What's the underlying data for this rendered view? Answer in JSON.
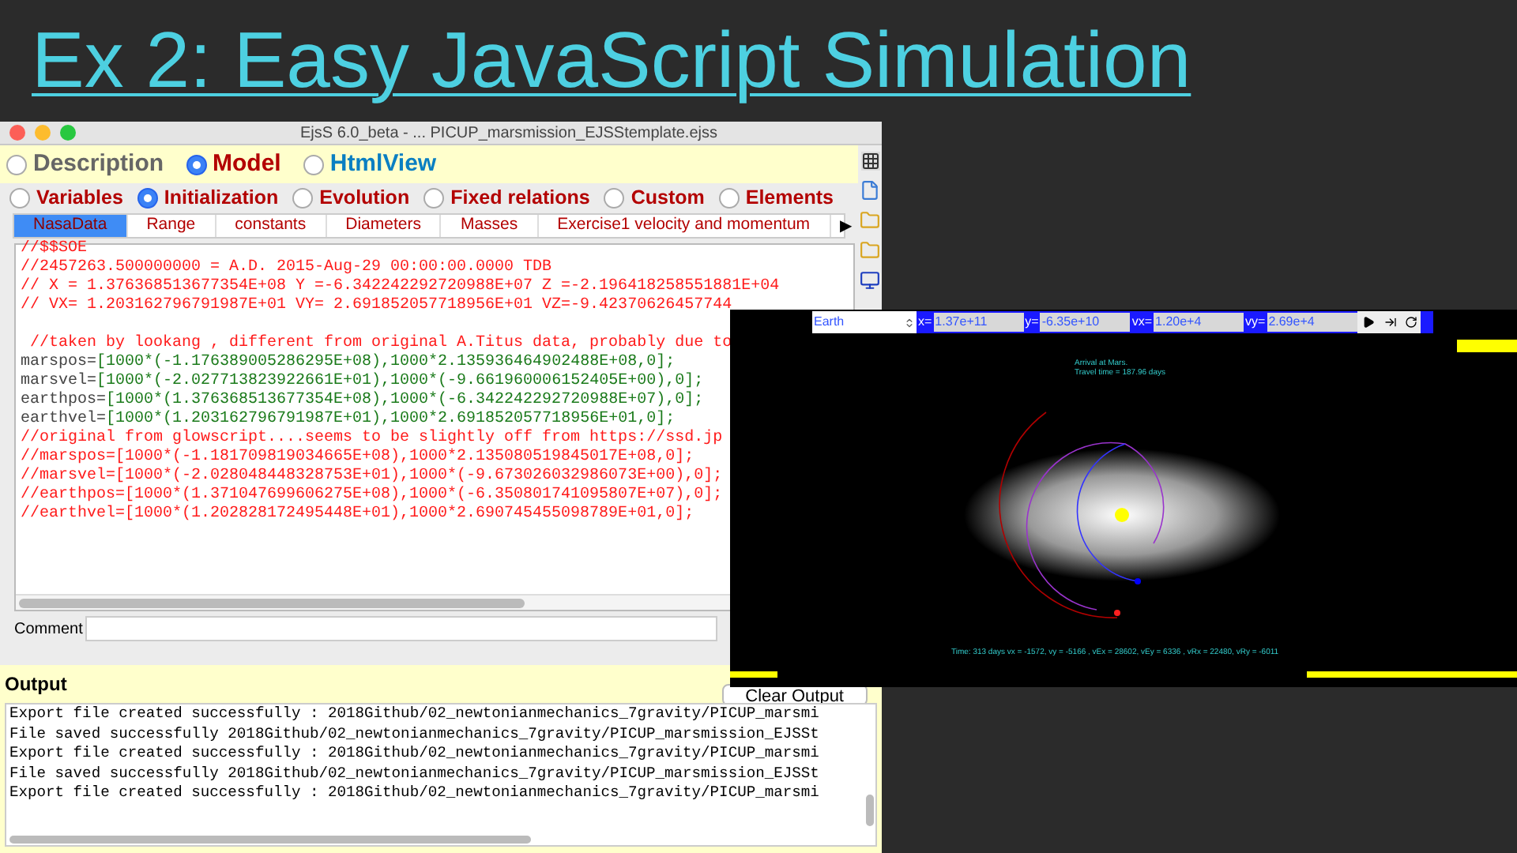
{
  "slide_title": "Ex 2: Easy JavaScript Simulation",
  "editor": {
    "title": "EjsS 6.0_beta - ... PICUP_marsmission_EJSStemplate.ejss",
    "view_options": [
      {
        "label": "Description",
        "selected": false
      },
      {
        "label": "Model",
        "selected": true
      },
      {
        "label": "HtmlView",
        "selected": false
      }
    ],
    "model_options": [
      {
        "label": "Variables",
        "selected": false
      },
      {
        "label": "Initialization",
        "selected": true
      },
      {
        "label": "Evolution",
        "selected": false
      },
      {
        "label": "Fixed relations",
        "selected": false
      },
      {
        "label": "Custom",
        "selected": false
      },
      {
        "label": "Elements",
        "selected": false
      }
    ],
    "pages": [
      {
        "label": "NasaData",
        "selected": true
      },
      {
        "label": "Range",
        "selected": false
      },
      {
        "label": "constants",
        "selected": false
      },
      {
        "label": "Diameters",
        "selected": false
      },
      {
        "label": "Masses",
        "selected": false
      },
      {
        "label": "Exercise1 velocity and momentum",
        "selected": false
      }
    ],
    "more_pages": "▶",
    "code_lines": [
      {
        "kind": "comment",
        "text": "//$$SOE"
      },
      {
        "kind": "comment",
        "text": "//2457263.500000000 = A.D. 2015-Aug-29 00:00:00.0000 TDB"
      },
      {
        "kind": "comment",
        "text": "// X = 1.376368513677354E+08 Y =-6.342242292720988E+07 Z =-2.196418258551881E+04"
      },
      {
        "kind": "comment",
        "text": "// VX= 1.203162796791987E+01 VY= 2.691852057718956E+01 VZ=-9.42370626457744"
      },
      {
        "kind": "blank"
      },
      {
        "kind": "comment",
        "text": " //taken by lookang , different from original A.Titus data, probably due to"
      },
      {
        "kind": "code",
        "name": "marspos=",
        "text": "[1000*(-1.176389005286295E+08),1000*2.135936464902488E+08,0];"
      },
      {
        "kind": "code",
        "name": "marsvel=",
        "text": "[1000*(-2.027713823922661E+01),1000*(-9.661960006152405E+00),0];"
      },
      {
        "kind": "code",
        "name": "earthpos=",
        "text": "[1000*(1.376368513677354E+08),1000*(-6.342242292720988E+07),0];"
      },
      {
        "kind": "code",
        "name": "earthvel=",
        "text": "[1000*(1.203162796791987E+01),1000*2.691852057718956E+01,0];"
      },
      {
        "kind": "comment",
        "text": "//original from glowscript....seems to be slightly off from https://ssd.jp"
      },
      {
        "kind": "comment",
        "text": "//marspos=[1000*(-1.181709819034665E+08),1000*2.135080519845017E+08,0];"
      },
      {
        "kind": "comment",
        "text": "//marsvel=[1000*(-2.028048448328753E+01),1000*(-9.673026032986073E+00),0];"
      },
      {
        "kind": "comment",
        "text": "//earthpos=[1000*(1.371047699606275E+08),1000*(-6.350801741095807E+07),0];"
      },
      {
        "kind": "comment",
        "text": "//earthvel=[1000*(1.202828172495448E+01),1000*2.690745455098789E+01,0];"
      }
    ],
    "comment_label": "Comment",
    "output": {
      "title": "Output",
      "clear_button": "Clear Output",
      "lines": [
        "Export file created successfully : 2018Github/02_newtonianmechanics_7gravity/PICUP_marsmi",
        "File saved successfully 2018Github/02_newtonianmechanics_7gravity/PICUP_marsmission_EJSSt",
        "Export file created successfully : 2018Github/02_newtonianmechanics_7gravity/PICUP_marsmi",
        "File saved successfully 2018Github/02_newtonianmechanics_7gravity/PICUP_marsmission_EJSSt",
        "Export file created successfully : 2018Github/02_newtonianmechanics_7gravity/PICUP_marsmi"
      ]
    }
  },
  "simulation": {
    "body_select": "Earth",
    "fields": [
      {
        "label": "x=",
        "value": "1.37e+11"
      },
      {
        "label": "y=",
        "value": "-6.35e+10"
      },
      {
        "label": "vx=",
        "value": "1.20e+4"
      },
      {
        "label": "vy=",
        "value": "2.69e+4"
      }
    ],
    "arrival_text": [
      "Arrival at Mars.",
      "Travel time = 187.96 days"
    ],
    "status": "Time: 313 days vx = -1572, vy = -5166 , vEx = 28602, vEy = 6336 , vRx = 22480, vRy = -6011"
  }
}
